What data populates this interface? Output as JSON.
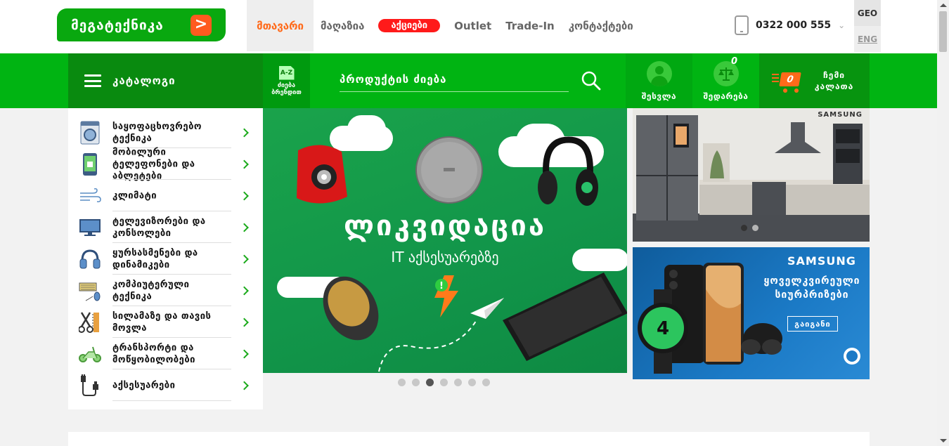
{
  "logo": {
    "text": "მეგატექნიკა",
    "badge": ">"
  },
  "nav": {
    "items": [
      {
        "label": "მთავარი",
        "active": true
      },
      {
        "label": "მაღაზია"
      },
      {
        "label": "აქციები",
        "promo": true
      },
      {
        "label": "Outlet"
      },
      {
        "label": "Trade-In"
      },
      {
        "label": "კონტაქტები"
      }
    ]
  },
  "phone": {
    "number": "0322 000 555",
    "chevron": "⌄"
  },
  "lang": {
    "geo": "GEO",
    "eng": "ENG"
  },
  "greenbar": {
    "catalog_label": "კატალოგი",
    "az": {
      "icon": "A-Z",
      "label": "ძიება ბრენდით"
    },
    "search": {
      "placeholder": "პროდუქტის ძიება"
    },
    "login_label": "შესვლა",
    "compare_label": "შედარება",
    "compare_count": "0",
    "cart_label": "ჩემი კალათა",
    "cart_count": "0"
  },
  "categories": [
    {
      "label": "საყოფაცხოვრებო ტექნიკა",
      "icon": "washing-machine-icon"
    },
    {
      "label": "მობილური ტელეფონები და აბლეტები",
      "icon": "mobile-phone-icon"
    },
    {
      "label": "კლიმატი",
      "icon": "wind-icon"
    },
    {
      "label": "ტელევიზორები და კონსოლები",
      "icon": "tv-icon"
    },
    {
      "label": "ყურსასმენები და დინამიკები",
      "icon": "headphones-icon"
    },
    {
      "label": "კომპიუტერული ტექნიკა",
      "icon": "keyboard-mouse-icon"
    },
    {
      "label": "სილამაზე და თავის მოვლა",
      "icon": "scissors-comb-icon"
    },
    {
      "label": "ტრანსპორტი და მოწყობილობები",
      "icon": "scooter-icon"
    },
    {
      "label": "აქსესუარები",
      "icon": "cable-icon"
    }
  ],
  "hero": {
    "title": "ლიკვიდაცია",
    "subtitle": "IT აქსესუარებზე",
    "slide_count": 7,
    "active_slide": 3,
    "colors": {
      "bg": "#12964a"
    }
  },
  "banner_top": {
    "brand": "SAMSUNG",
    "slide_count": 2,
    "active_slide": 1
  },
  "banner_bottom": {
    "brand": "SAMSUNG",
    "title": "ყოველკვირეული სიურპრიზები",
    "button": "გაიგანი"
  },
  "colors": {
    "primary_green": "#00b412",
    "dark_green": "#098a0f",
    "accent_orange": "#ff6a1a",
    "promo_red": "#ff1a1a"
  }
}
